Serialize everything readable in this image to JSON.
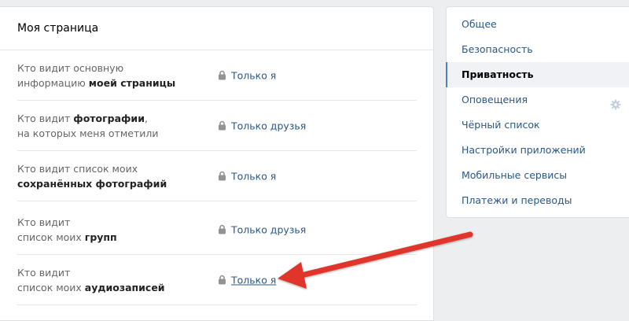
{
  "main": {
    "title": "Моя страница",
    "rows": [
      {
        "line1": "Кто видит основную",
        "line2_plain": "информацию ",
        "line2_bold": "моей страницы",
        "value": "Только я"
      },
      {
        "line1_plain": "Кто видит ",
        "line1_bold": "фотографии",
        "line1_tail": ",",
        "line2": "на которых меня отметили",
        "value": "Только друзья"
      },
      {
        "line1": "Кто видит список моих",
        "line2_bold": "сохранённых фотографий",
        "value": "Только я"
      },
      {
        "line1": "Кто видит",
        "line2_plain": "список моих ",
        "line2_bold": "групп",
        "value": "Только друзья"
      },
      {
        "line1": "Кто видит",
        "line2_plain": "список моих ",
        "line2_bold": "аудиозаписей",
        "value": "Только я"
      }
    ]
  },
  "sidebar": {
    "items": [
      {
        "label": "Общее"
      },
      {
        "label": "Безопасность"
      },
      {
        "label": "Приватность"
      },
      {
        "label": "Оповещения"
      },
      {
        "label": "Чёрный список"
      },
      {
        "label": "Настройки приложений"
      },
      {
        "label": "Мобильные сервисы"
      },
      {
        "label": "Платежи и переводы"
      }
    ],
    "active_index": 2
  },
  "icons": {
    "lock": "lock-icon",
    "gear": "gear-icon"
  },
  "colors": {
    "link": "#2a5885",
    "accent": "#5181b8",
    "arrow": "#e0352b",
    "background": "#edeef0"
  }
}
